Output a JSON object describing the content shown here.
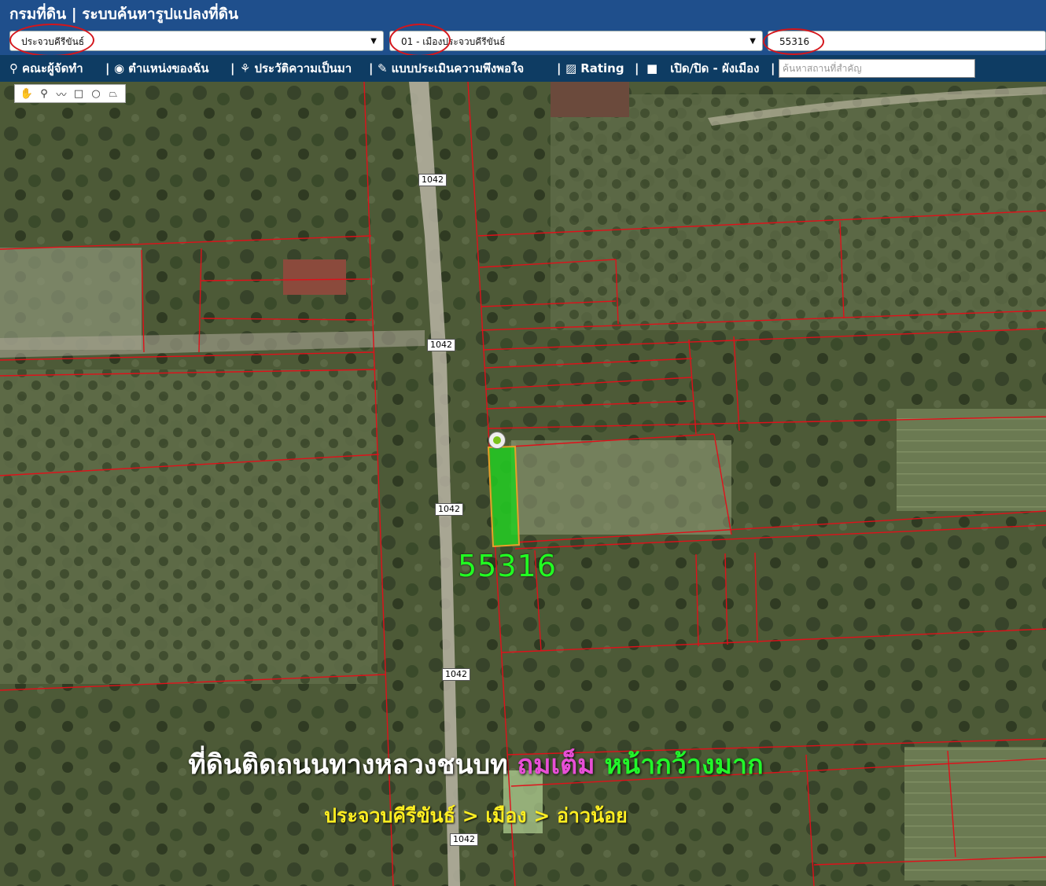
{
  "title": "กรมที่ดิน | ระบบค้นหารูปแปลงที่ดิน",
  "selects": {
    "province": "ประจวบคีรีขันธ์",
    "district": "01 - เมืองประจวบคีรีขันธ์",
    "parcel_number": "55316"
  },
  "toolbar": {
    "items": [
      {
        "label": "คณะผู้จัดทำ",
        "icon": "person-icon"
      },
      {
        "label": "ตำแหน่งของฉัน",
        "icon": "globe-icon"
      },
      {
        "label": "ประวัติความเป็นมา",
        "icon": "history-icon"
      },
      {
        "label": "แบบประเมินความพึงพอใจ",
        "icon": "survey-icon"
      },
      {
        "label": "Rating",
        "icon": "chart-icon"
      },
      {
        "label": "เปิด/ปิด - ผังเมือง",
        "icon": "checkbox-icon"
      }
    ],
    "search_placeholder": "ค้นหาสถานที่สำคัญ"
  },
  "draw_tools": [
    "pan-hand-icon",
    "marker-icon",
    "polyline-icon",
    "rectangle-icon",
    "circle-icon",
    "polygon-icon"
  ],
  "map": {
    "road_shields": [
      "1042",
      "1042",
      "1042",
      "1042",
      "1042"
    ],
    "parcel_label": "55316",
    "highlight_color": "#22cc22",
    "boundary_color": "#e0101a"
  },
  "captions": {
    "line1_a": "ที่ดินติดถนนทางหลวงชนบท",
    "line1_b": "ถมเต็ม",
    "line1_c": "หน้ากว้างมาก",
    "line2": "ประจวบคีรีขันธ์ > เมือง > อ่าวน้อย"
  }
}
